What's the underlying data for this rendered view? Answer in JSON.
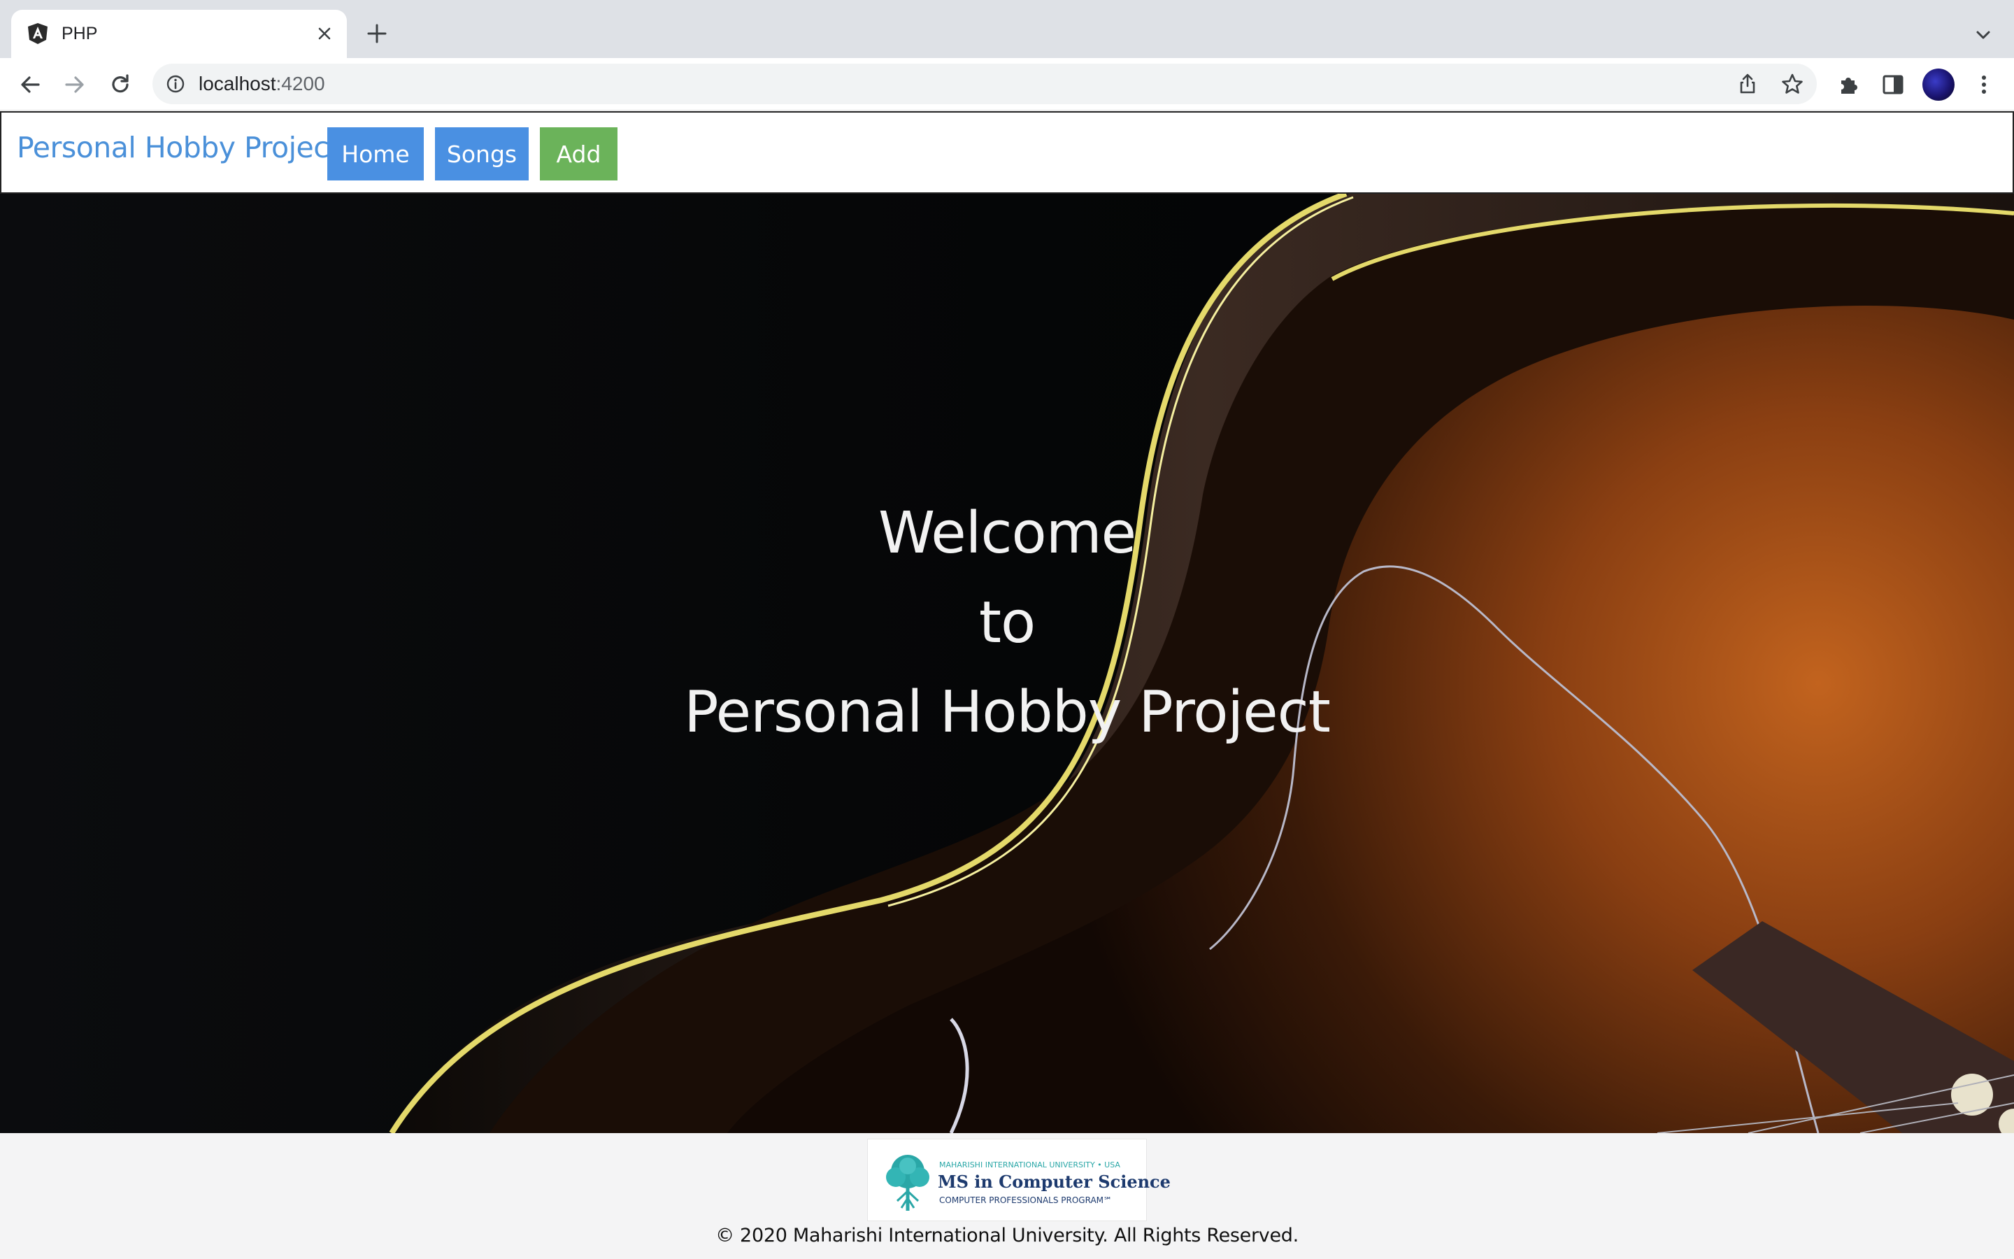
{
  "browser": {
    "tab": {
      "title": "PHP",
      "favicon": "angular-icon"
    },
    "address": {
      "host": "localhost",
      "port": ":4200"
    },
    "icons": [
      "back-arrow-icon",
      "forward-arrow-icon",
      "reload-icon",
      "info-icon",
      "share-icon",
      "bookmark-star-icon",
      "extensions-puzzle-icon",
      "side-panel-icon",
      "profile-avatar",
      "kebab-menu-icon",
      "tab-search-chevron-icon",
      "new-tab-plus-icon",
      "tab-close-icon"
    ]
  },
  "navbar": {
    "brand": "Personal Hobby Project",
    "buttons": {
      "home": "Home",
      "songs": "Songs",
      "add": "Add"
    },
    "colors": {
      "brand": "#4a90d9",
      "primary": "#4a90e2",
      "success": "#6bb35a"
    }
  },
  "hero": {
    "line1": "Welcome",
    "line2": "to",
    "line3": "Personal Hobby Project"
  },
  "footer": {
    "logo": {
      "top": "MAHARISHI INTERNATIONAL UNIVERSITY • USA",
      "main": "MS in Computer Science",
      "sub": "COMPUTER PROFESSIONALS PROGRAM℠"
    },
    "copyright": "© 2020 Maharishi International University. All Rights Reserved."
  }
}
